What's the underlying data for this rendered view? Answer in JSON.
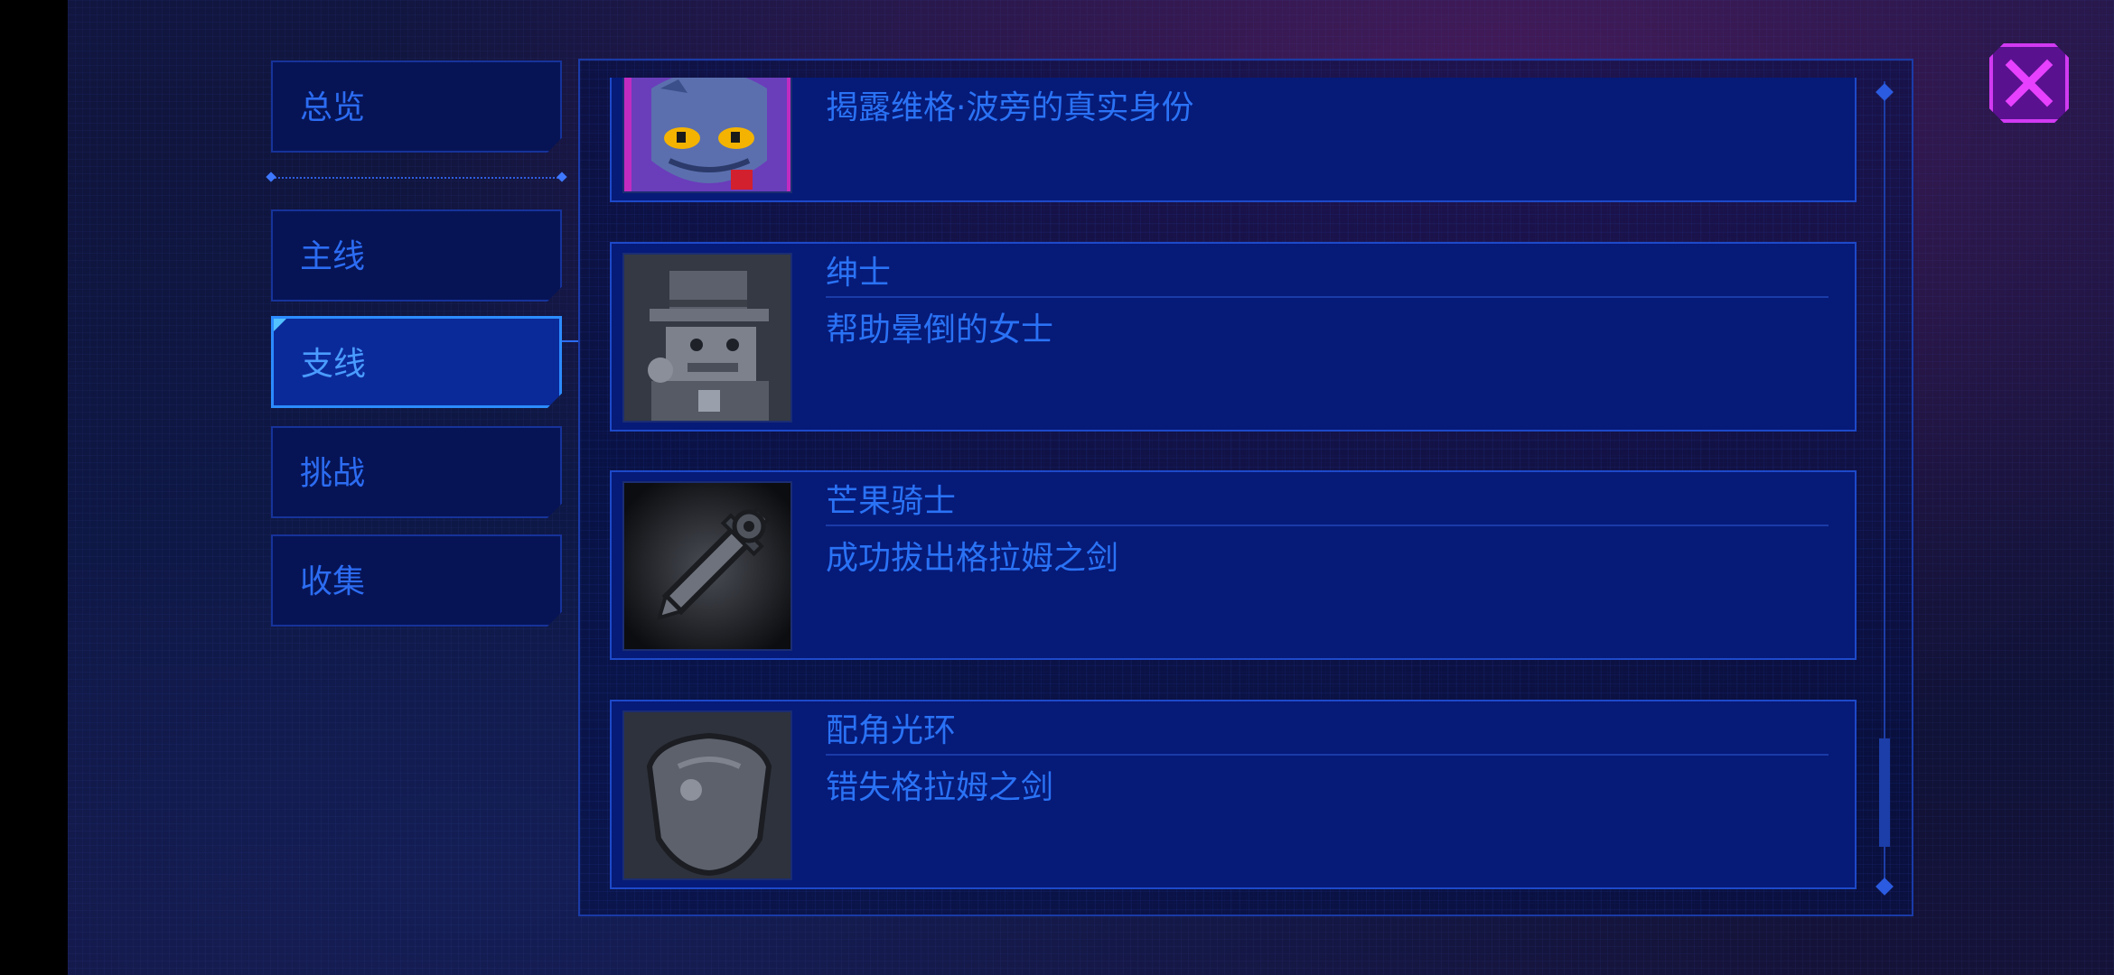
{
  "nav": {
    "overview": "总览",
    "tabs": [
      {
        "label": "主线"
      },
      {
        "label": "支线",
        "active": true
      },
      {
        "label": "挑战"
      },
      {
        "label": "收集"
      }
    ]
  },
  "achievements": [
    {
      "name": "",
      "description": "揭露维格·波旁的真实身份",
      "icon": "blue-cat-portrait-icon"
    },
    {
      "name": "绅士",
      "description": "帮助晕倒的女士",
      "icon": "gentleman-top-hat-icon"
    },
    {
      "name": "芒果骑士",
      "description": "成功拔出格拉姆之剑",
      "icon": "sword-icon"
    },
    {
      "name": "配角光环",
      "description": "错失格拉姆之剑",
      "icon": "shield-icon"
    }
  ],
  "close_icon": "close-x-icon",
  "colors": {
    "accent_blue": "#2a72f5",
    "active_tab": "#0b2a9a",
    "close_magenta": "#d13af2"
  }
}
